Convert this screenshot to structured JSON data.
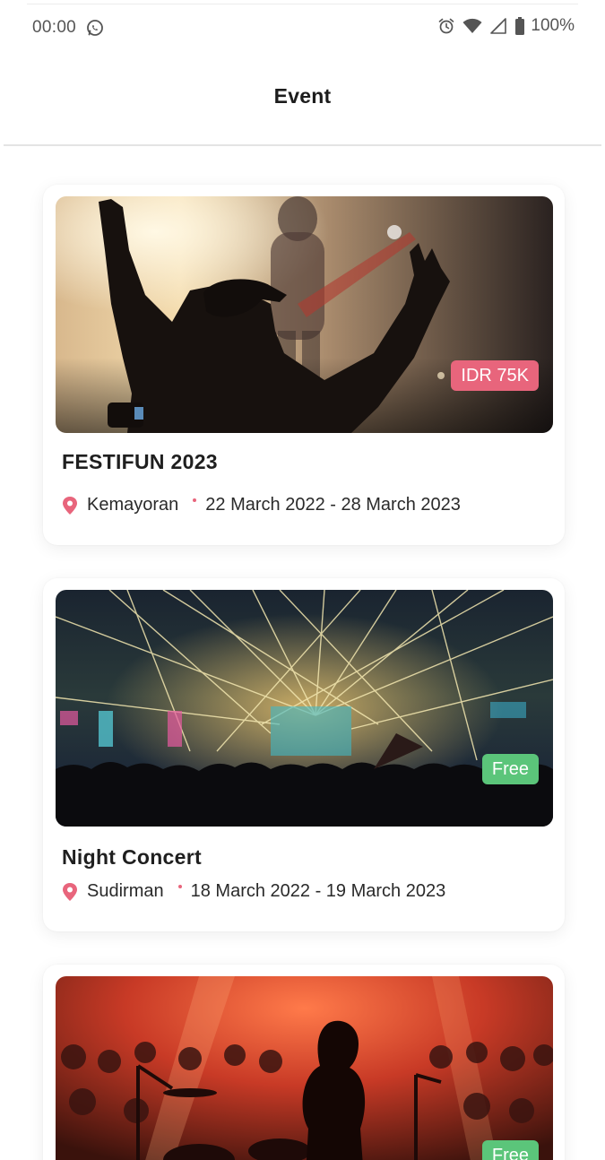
{
  "status_bar": {
    "time": "00:00",
    "battery": "100%",
    "icons": [
      "whatsapp-icon",
      "alarm-icon",
      "wifi-icon",
      "signal-icon",
      "battery-icon"
    ]
  },
  "header": {
    "title": "Event"
  },
  "events": [
    {
      "title": "FESTIFUN 2023",
      "location": "Kemayoran",
      "dates": "22 March 2022 - 28 March 2023",
      "price": "IDR 75K",
      "price_color": "#e8657c",
      "image": "rock-concert-fan-silhouette"
    },
    {
      "title": "Night Concert",
      "location": "Sudirman",
      "dates": "18 March 2022 - 19 March 2023",
      "price": "Free",
      "price_color": "#5bc57a",
      "image": "laser-light-concert-crowd"
    },
    {
      "title": "",
      "location": "",
      "dates": "",
      "price": "Free",
      "price_color": "#5bc57a",
      "image": "red-stage-band-crowd"
    }
  ],
  "colors": {
    "accent": "#e8657c",
    "free": "#5bc57a"
  }
}
